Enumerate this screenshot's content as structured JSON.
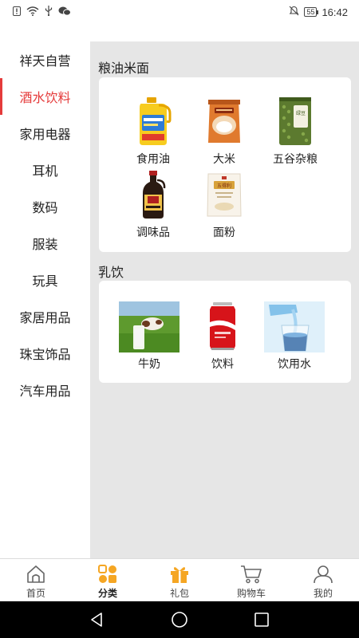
{
  "status_bar": {
    "time": "16:42",
    "battery": "55"
  },
  "sidebar": {
    "items": [
      {
        "label": "祥天自营"
      },
      {
        "label": "酒水饮料"
      },
      {
        "label": "家用电器"
      },
      {
        "label": "耳机"
      },
      {
        "label": "数码"
      },
      {
        "label": "服装"
      },
      {
        "label": "玩具"
      },
      {
        "label": "家居用品"
      },
      {
        "label": "珠宝饰品"
      },
      {
        "label": "汽车用品"
      }
    ],
    "active_index": 1
  },
  "sections": [
    {
      "title": "粮油米面",
      "products": [
        {
          "label": "食用油"
        },
        {
          "label": "大米"
        },
        {
          "label": "五谷杂粮"
        },
        {
          "label": "调味品"
        },
        {
          "label": "面粉"
        }
      ]
    },
    {
      "title": "乳饮",
      "products": [
        {
          "label": "牛奶"
        },
        {
          "label": "饮料"
        },
        {
          "label": "饮用水"
        }
      ]
    }
  ],
  "product_texts": {
    "beans_tag": "绿豆",
    "flour_tag": "五得利"
  },
  "tabbar": {
    "tabs": [
      {
        "label": "首页",
        "icon": "home-icon"
      },
      {
        "label": "分类",
        "icon": "category-icon"
      },
      {
        "label": "礼包",
        "icon": "gift-icon"
      },
      {
        "label": "购物车",
        "icon": "cart-icon"
      },
      {
        "label": "我的",
        "icon": "profile-icon"
      }
    ],
    "active_index": 1
  },
  "colors": {
    "accent": "#e53b3b",
    "tab_active": "#f5a623",
    "content_bg": "#e6e6e6"
  }
}
